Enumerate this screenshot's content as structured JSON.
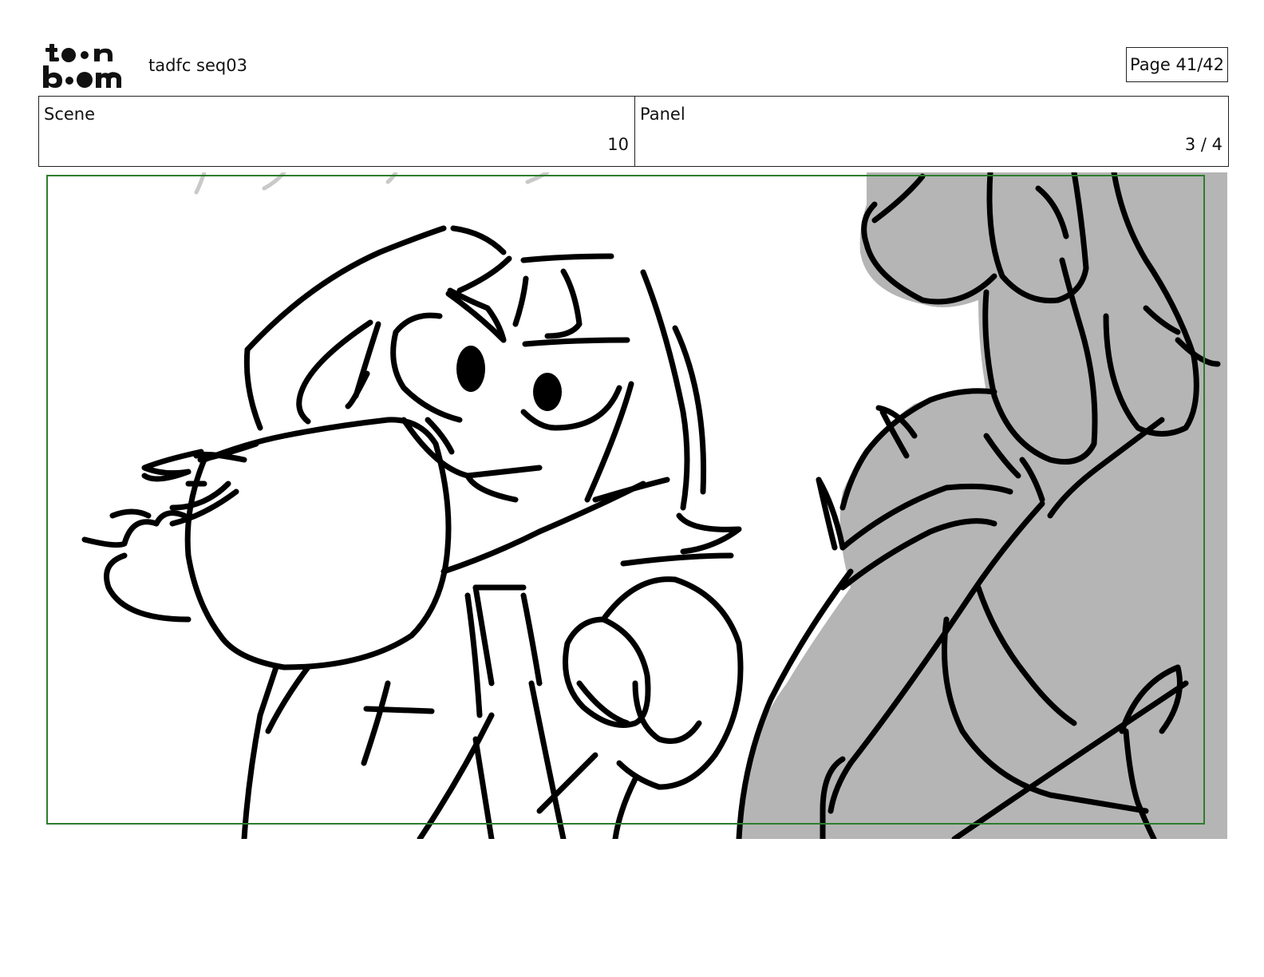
{
  "header": {
    "logo_text": "toon boom",
    "project_title": "tadfc seq03",
    "page_label": "Page 41/42"
  },
  "info": {
    "scene_label": "Scene",
    "scene_value": "10",
    "panel_label": "Panel",
    "panel_value": "3 / 4"
  },
  "panel": {
    "frame_color": "#2e7d2e",
    "shade_color": "#b5b5b5",
    "line_color": "#000000"
  }
}
